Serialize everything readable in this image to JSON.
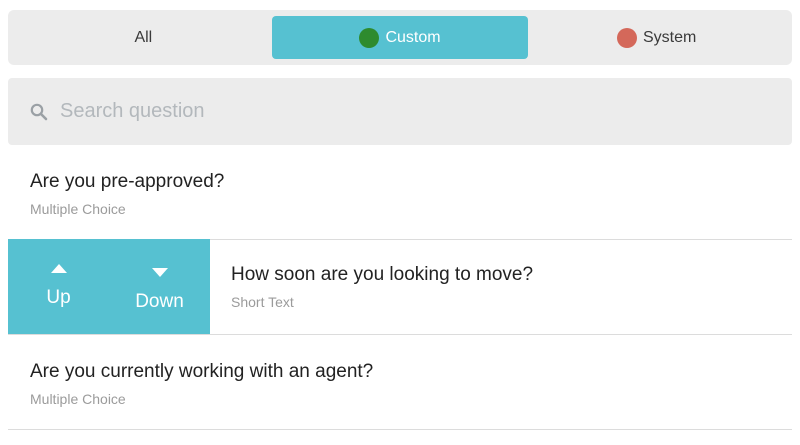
{
  "filters": {
    "all_label": "All",
    "custom_label": "Custom",
    "system_label": "System",
    "active": "custom",
    "custom_color": "#2e8b2e",
    "system_color": "#d4685a",
    "accent_color": "#56c1d1"
  },
  "search": {
    "placeholder": "Search question",
    "value": ""
  },
  "questions": [
    {
      "title": "Are you pre-approved?",
      "type": "Multiple Choice"
    },
    {
      "title": "How soon are you looking to move?",
      "type": "Short Text",
      "actions": {
        "up_label": "Up",
        "down_label": "Down"
      }
    },
    {
      "title": "Are you currently working with an agent?",
      "type": "Multiple Choice"
    }
  ]
}
